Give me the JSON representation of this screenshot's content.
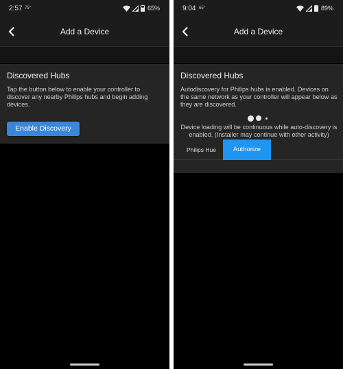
{
  "left": {
    "status": {
      "time": "2:57",
      "temp": "75°",
      "battery": "65%"
    },
    "app_bar": {
      "title": "Add a Device"
    },
    "card": {
      "title": "Discovered Hubs",
      "body": "Tap the button below to enable your controller to discover any nearby Philips hubs and begin adding devices.",
      "button_label": "Enable Discovery"
    }
  },
  "right": {
    "status": {
      "time": "9:04",
      "temp": "65°",
      "battery": "89%"
    },
    "app_bar": {
      "title": "Add a Device"
    },
    "card": {
      "title": "Discovered Hubs",
      "body": "Autodiscovery for Philips hubs is enabled. Devices on the same network as your controller will appear below as they are discovered.",
      "loading_note": "Device loading will be continuous while auto-discovery is enabled. (Installer may continue with other activity)",
      "device": {
        "name": "Philips Hue",
        "action_label": "Authorize"
      }
    }
  },
  "icons": {
    "back": "chevron-left-icon",
    "wifi": "wifi-icon",
    "signal": "cell-signal-icon",
    "battery": "battery-icon"
  },
  "colors": {
    "accent_button": "#3a86d9",
    "authorize_button": "#1e95f0",
    "background": "#000000",
    "card": "#252525"
  }
}
